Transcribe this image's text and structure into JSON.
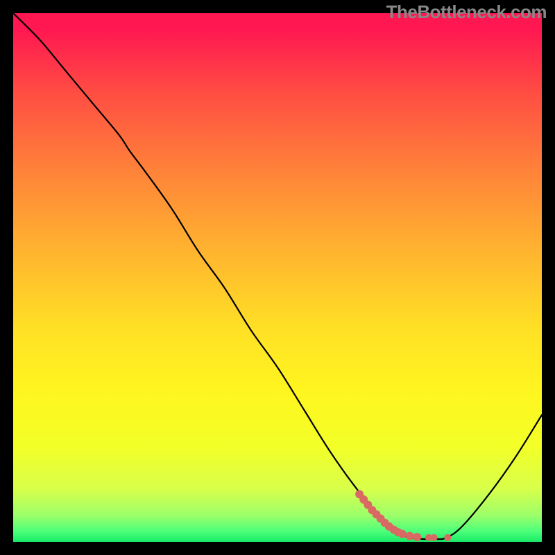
{
  "watermark": "TheBottleneck.com",
  "chart_data": {
    "type": "line",
    "title": "",
    "xlabel": "",
    "ylabel": "",
    "xlim": [
      0,
      100
    ],
    "ylim": [
      0,
      100
    ],
    "series": [
      {
        "name": "bottleneck-curve",
        "x": [
          0,
          5,
          10,
          15,
          20,
          22,
          25,
          30,
          35,
          40,
          45,
          50,
          55,
          60,
          65,
          70,
          72,
          75,
          78,
          80,
          82,
          85,
          90,
          95,
          100
        ],
        "y": [
          100,
          95,
          89,
          83,
          77,
          74,
          70,
          63,
          55,
          48,
          40,
          33,
          25,
          17,
          10,
          4,
          2,
          0.8,
          0.5,
          0.5,
          0.8,
          3,
          9,
          16,
          24
        ]
      }
    ],
    "markers": {
      "name": "highlight-points",
      "color": "#d96a63",
      "x": [
        65.5,
        66.3,
        67.1,
        67.9,
        68.7,
        69.5,
        70.3,
        71.1,
        72.0,
        72.8,
        73.6,
        75.0,
        76.4,
        78.6,
        79.6,
        82.2
      ],
      "y": [
        9.0,
        8.0,
        7.0,
        6.0,
        5.2,
        4.4,
        3.6,
        2.9,
        2.3,
        1.8,
        1.5,
        1.1,
        0.9,
        0.8,
        0.8,
        0.8
      ],
      "r": [
        6,
        6,
        6,
        6,
        6,
        6,
        6,
        6,
        6,
        6,
        6,
        6,
        6,
        5,
        5,
        5
      ]
    },
    "background_gradient_stops": [
      {
        "pos": 0,
        "color": "#ff1751"
      },
      {
        "pos": 50,
        "color": "#ffd028"
      },
      {
        "pos": 100,
        "color": "#18eb67"
      }
    ]
  }
}
